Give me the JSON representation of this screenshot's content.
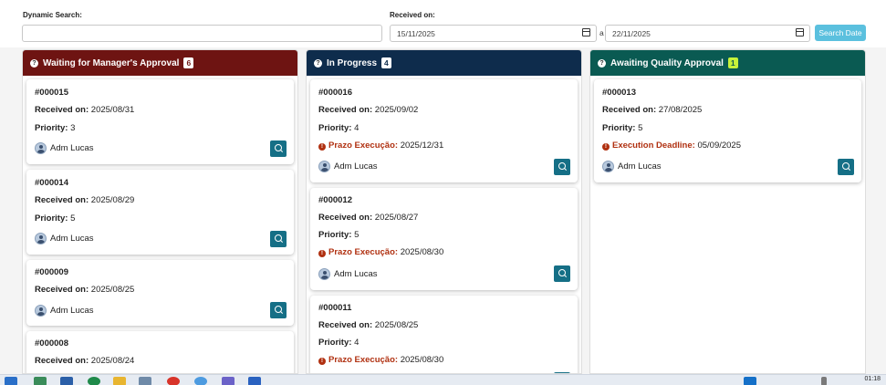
{
  "filters": {
    "dynamic_search_label": "Dynamic Search:",
    "dynamic_search_value": "",
    "received_on_label": "Received on:",
    "date_from": "15/11/2025",
    "date_separator": "a",
    "date_to": "22/11/2025",
    "search_button": "Search Date"
  },
  "columns": [
    {
      "title": "Waiting for Manager's Approval",
      "count": "6",
      "color": "#6e1412",
      "cards": [
        {
          "id": "#000015",
          "received_label": "Received on:",
          "received": "2025/08/31",
          "priority_label": "Priority:",
          "priority": "3",
          "user": "Adm Lucas"
        },
        {
          "id": "#000014",
          "received_label": "Received on:",
          "received": "2025/08/29",
          "priority_label": "Priority:",
          "priority": "5",
          "user": "Adm Lucas"
        },
        {
          "id": "#000009",
          "received_label": "Received on:",
          "received": "2025/08/25",
          "user": "Adm Lucas"
        },
        {
          "id": "#000008",
          "received_label": "Received on:",
          "received": "2025/08/24"
        }
      ]
    },
    {
      "title": "In Progress",
      "count": "4",
      "color": "#0e2c4c",
      "cards": [
        {
          "id": "#000016",
          "received_label": "Received on:",
          "received": "2025/09/02",
          "priority_label": "Priority:",
          "priority": "4",
          "deadline_label": "Prazo Execução:",
          "deadline": "2025/12/31",
          "user": "Adm Lucas"
        },
        {
          "id": "#000012",
          "received_label": "Received on:",
          "received": "2025/08/27",
          "priority_label": "Priority:",
          "priority": "5",
          "deadline_label": "Prazo Execução:",
          "deadline": "2025/08/30",
          "user": "Adm Lucas"
        },
        {
          "id": "#000011",
          "received_label": "Received on:",
          "received": "2025/08/25",
          "priority_label": "Priority:",
          "priority": "4",
          "deadline_label": "Prazo Execução:",
          "deadline": "2025/08/30"
        }
      ]
    },
    {
      "title": "Awaiting Quality Approval",
      "count": "1",
      "color": "#0a5a52",
      "cards": [
        {
          "id": "#000013",
          "received_label": "Received on:",
          "received": "27/08/2025",
          "priority_label": "Priority:",
          "priority": "5",
          "deadline_label": "Execution Deadline:",
          "deadline": "05/09/2025",
          "user": "Adm Lucas"
        }
      ]
    }
  ],
  "taskbar": {
    "time": "01:18"
  }
}
